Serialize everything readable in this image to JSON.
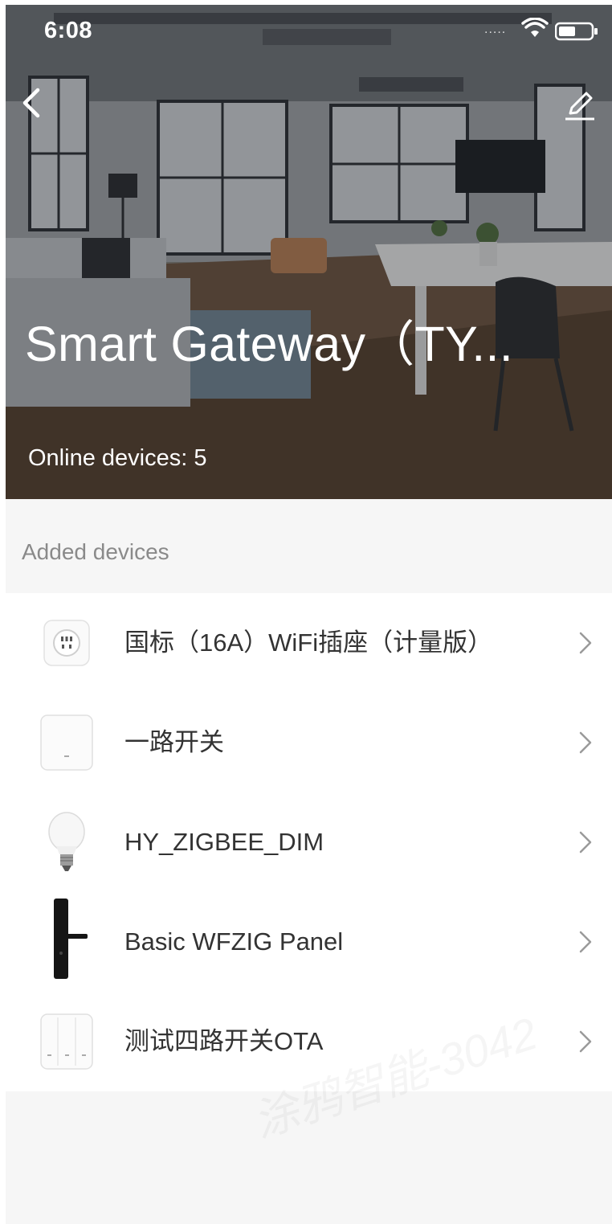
{
  "status_bar": {
    "time": "6:08",
    "signal": "....."
  },
  "header": {
    "title": "Smart Gateway（TY...",
    "online_devices": "Online devices: 5",
    "back_icon": "chevron-left-icon",
    "edit_icon": "pencil-icon"
  },
  "section": {
    "label": "Added devices"
  },
  "devices": [
    {
      "name": "国标（16A）WiFi插座（计量版）",
      "icon": "socket-icon"
    },
    {
      "name": "一路开关",
      "icon": "switch-1gang-icon"
    },
    {
      "name": "HY_ZIGBEE_DIM",
      "icon": "bulb-icon"
    },
    {
      "name": "Basic WFZIG Panel",
      "icon": "door-lock-icon"
    },
    {
      "name": "测试四路开关OTA",
      "icon": "switch-3gang-icon"
    }
  ],
  "watermark": "涂鸦智能-3042",
  "colors": {
    "list_bg": "#ffffff",
    "page_bg": "#f6f6f6",
    "chevron": "#9a9a9a",
    "label": "#8a8a8a"
  }
}
